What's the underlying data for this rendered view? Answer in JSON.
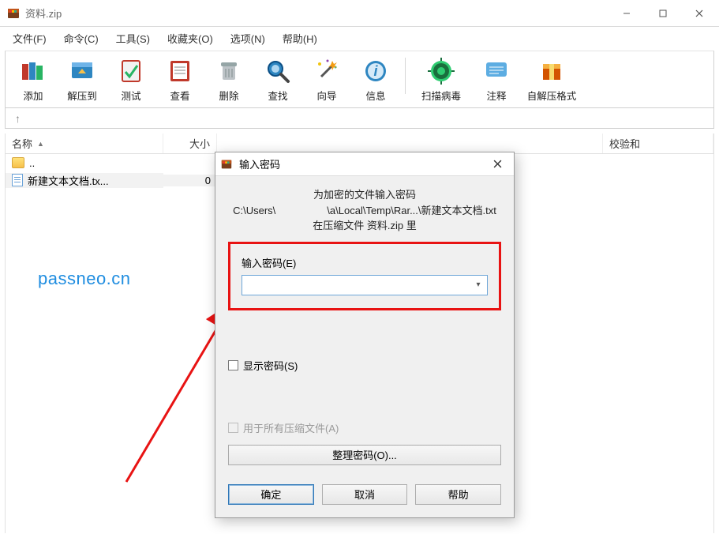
{
  "window": {
    "title": "资料.zip",
    "controls": {
      "minimize": "—",
      "maximize": "□",
      "close": "✕"
    }
  },
  "menu": {
    "file": "文件(F)",
    "command": "命令(C)",
    "tools": "工具(S)",
    "favorites": "收藏夹(O)",
    "options": "选项(N)",
    "help": "帮助(H)"
  },
  "toolbar": {
    "add": "添加",
    "extract": "解压到",
    "test": "测试",
    "view": "查看",
    "delete": "删除",
    "find": "查找",
    "wizard": "向导",
    "info": "信息",
    "virus": "扫描病毒",
    "comment": "注释",
    "sfx": "自解压格式"
  },
  "nav": {
    "up": "↑"
  },
  "columns": {
    "name": "名称",
    "size": "大小",
    "checksum": "校验和"
  },
  "rows": {
    "parent": "..",
    "file1_name": "新建文本文档.tx...",
    "file1_size": "0"
  },
  "dialog": {
    "title": "输入密码",
    "line1": "为加密的文件输入密码",
    "path": "C:\\Users\\     \\a\\Local\\Temp\\Rar...\\新建文本文档.txt",
    "line3": "在压缩文件 资料.zip 里",
    "password_label": "输入密码(E)",
    "show_password": "显示密码(S)",
    "use_for_all": "用于所有压缩文件(A)",
    "organize": "整理密码(O)...",
    "ok": "确定",
    "cancel": "取消",
    "help": "帮助"
  },
  "watermark": "passneo.cn"
}
